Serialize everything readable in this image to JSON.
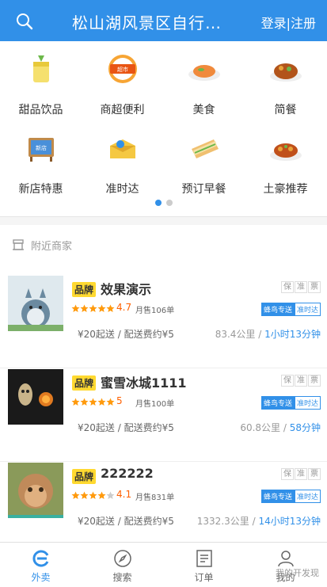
{
  "header": {
    "title": "松山湖风景区自行…",
    "login": "登录|注册"
  },
  "categories": [
    {
      "label": "甜品饮品",
      "icon": "drink-icon"
    },
    {
      "label": "商超便利",
      "icon": "supermarket-icon"
    },
    {
      "label": "美食",
      "icon": "food-icon"
    },
    {
      "label": "简餐",
      "icon": "simple-meal-icon"
    },
    {
      "label": "新店特惠",
      "icon": "new-store-icon"
    },
    {
      "label": "准时达",
      "icon": "on-time-icon"
    },
    {
      "label": "预订早餐",
      "icon": "breakfast-icon"
    },
    {
      "label": "土豪推荐",
      "icon": "recommend-icon"
    }
  ],
  "category_pages": {
    "count": 2,
    "active": 0
  },
  "nearby": {
    "title": "附近商家"
  },
  "shops": [
    {
      "brand": "品牌",
      "name": "效果演示",
      "services": [
        "保",
        "准",
        "票"
      ],
      "stars": 5,
      "rating": "4.7",
      "sales": "月售106单",
      "delivery_tag": "蜂鸟专送",
      "ontime_tag": "准时达",
      "fee": "¥20起送 / 配送费约¥5",
      "distance": "83.4公里",
      "time": "1小时13分钟"
    },
    {
      "brand": "品牌",
      "name": "蜜雪冰城1111",
      "services": [
        "保",
        "准",
        "票"
      ],
      "stars": 5,
      "rating": "5",
      "sales": "月售100单",
      "delivery_tag": "蜂鸟专送",
      "ontime_tag": "准时达",
      "fee": "¥20起送 / 配送费约¥5",
      "distance": "60.8公里",
      "time": "58分钟"
    },
    {
      "brand": "品牌",
      "name": "222222",
      "services": [
        "保",
        "准",
        "票"
      ],
      "stars": 4,
      "rating": "4.1",
      "sales": "月售831单",
      "delivery_tag": "蜂鸟专送",
      "ontime_tag": "准时达",
      "fee": "¥20起送 / 配送费约¥5",
      "distance": "1332.3公里",
      "time": "14小时13分钟"
    }
  ],
  "tabbar": [
    {
      "label": "外卖",
      "icon": "takeout-icon",
      "active": true
    },
    {
      "label": "搜索",
      "icon": "compass-icon",
      "active": false
    },
    {
      "label": "订单",
      "icon": "order-icon",
      "active": false
    },
    {
      "label": "我的",
      "icon": "user-icon",
      "active": false
    }
  ],
  "watermark": "我的开发现",
  "colors": {
    "primary": "#3190e8",
    "brand_tag": "#ffd930",
    "rating": "#ff6000",
    "star": "#ff9a0d"
  }
}
